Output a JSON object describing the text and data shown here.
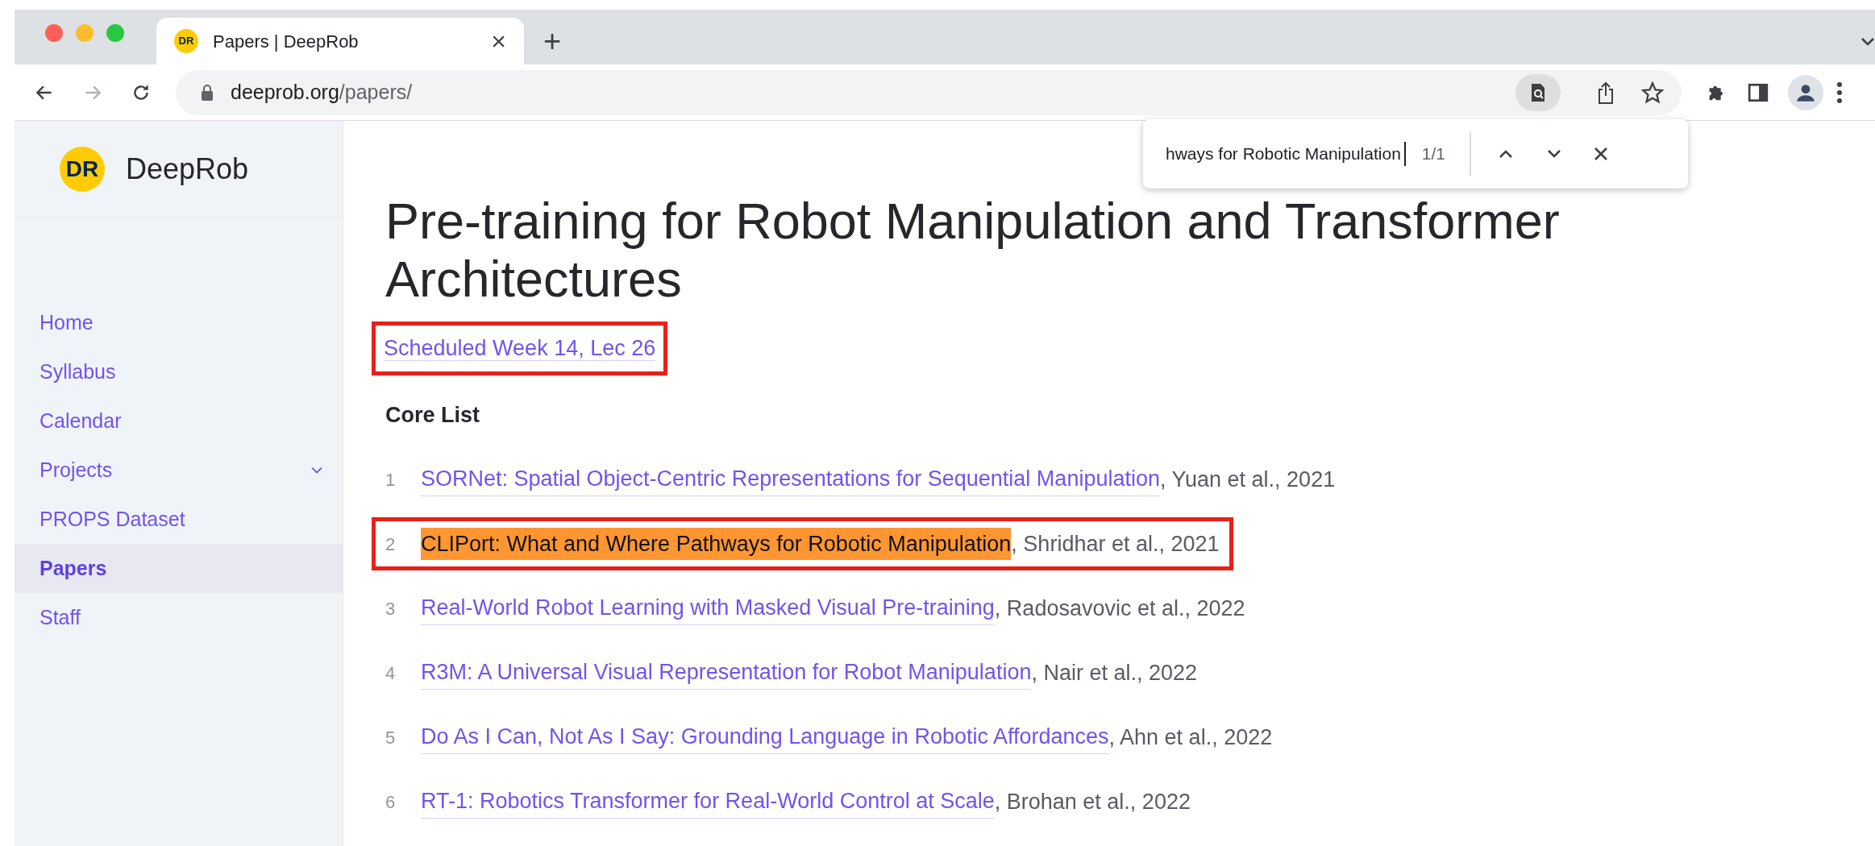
{
  "browser": {
    "tab": {
      "favicon": "DR",
      "title": "Papers | DeepRob",
      "close": "×"
    },
    "new_tab": "+",
    "url": {
      "host": "deeprob.org",
      "path": "/papers/"
    }
  },
  "find_bar": {
    "value": "hways for Robotic Manipulation",
    "count": "1/1"
  },
  "sidebar": {
    "logo": "DR",
    "site_name": "DeepRob",
    "items": [
      {
        "label": "Home",
        "selected": false,
        "expandable": false
      },
      {
        "label": "Syllabus",
        "selected": false,
        "expandable": false
      },
      {
        "label": "Calendar",
        "selected": false,
        "expandable": false
      },
      {
        "label": "Projects",
        "selected": false,
        "expandable": true
      },
      {
        "label": "PROPS Dataset",
        "selected": false,
        "expandable": false
      },
      {
        "label": "Papers",
        "selected": true,
        "expandable": false
      },
      {
        "label": "Staff",
        "selected": false,
        "expandable": false
      }
    ]
  },
  "page": {
    "title": "Pre-training for Robot Manipulation and Transformer Architectures",
    "schedule": {
      "text": "Scheduled Week 14, Lec 26",
      "boxed": true
    },
    "section": "Core List",
    "papers": [
      {
        "number": "1",
        "title": "SORNet: Spatial Object-Centric Representations for Sequential Manipulation",
        "authors": ", Yuan et al., 2021",
        "find_match": false,
        "boxed": false
      },
      {
        "number": "2",
        "title": "CLIPort: What and Where Pathways for Robotic Manipulation",
        "authors": ", Shridhar et al., 2021",
        "find_match": true,
        "boxed": true
      },
      {
        "number": "3",
        "title": "Real-World Robot Learning with Masked Visual Pre-training",
        "authors": ", Radosavovic et al., 2022",
        "find_match": false,
        "boxed": false
      },
      {
        "number": "4",
        "title": "R3M: A Universal Visual Representation for Robot Manipulation",
        "authors": ", Nair et al., 2022",
        "find_match": false,
        "boxed": false
      },
      {
        "number": "5",
        "title": "Do As I Can, Not As I Say: Grounding Language in Robotic Affordances",
        "authors": ", Ahn et al., 2022",
        "find_match": false,
        "boxed": false
      },
      {
        "number": "6",
        "title": "RT-1: Robotics Transformer for Real-World Control at Scale",
        "authors": ", Brohan et al., 2022",
        "find_match": false,
        "boxed": false
      }
    ]
  }
}
